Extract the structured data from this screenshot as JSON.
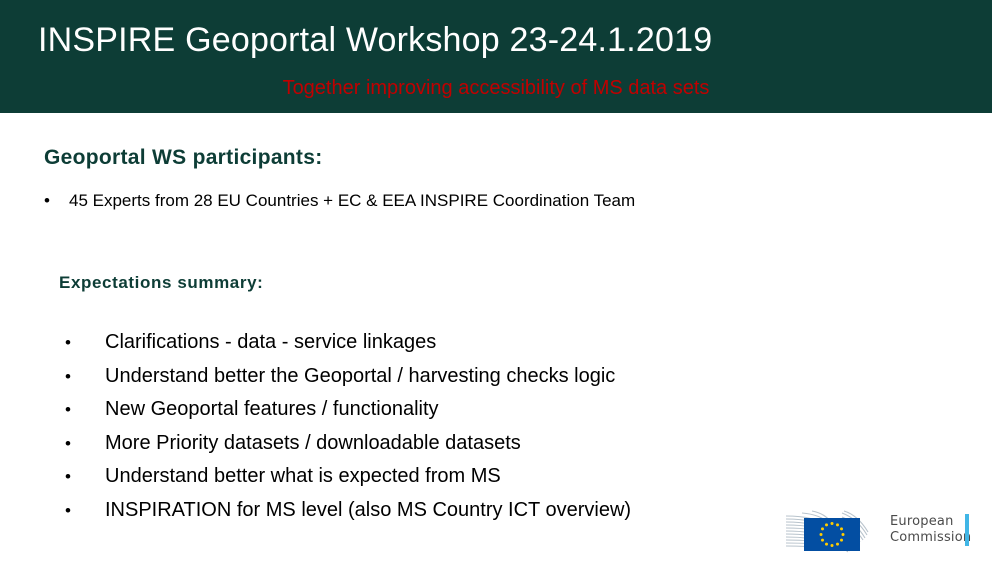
{
  "header": {
    "title": "INSPIRE Geoportal Workshop 23-24.1.2019",
    "subtitle": "Together improving accessibility of MS data sets",
    "background_color": "#0d3d36",
    "title_color": "#ffffff",
    "subtitle_color": "#c00000"
  },
  "body": {
    "participants": {
      "heading": "Geoportal WS participants:",
      "heading_color": "#0d3d36",
      "bullet_glyph": "•",
      "line": "45 Experts from 28 EU Countries + EC & EEA INSPIRE Coordination Team"
    },
    "expectations": {
      "heading": "Expectations summary:",
      "heading_color": "#0d3d36",
      "bullet_glyph": "•",
      "items": [
        "Clarifications - data - service linkages",
        "Understand better the Geoportal / harvesting checks logic",
        "New Geoportal features / functionality",
        "More Priority datasets / downloadable datasets",
        "Understand better what is expected from MS",
        "INSPIRATION for MS level (also MS Country ICT overview)"
      ]
    }
  },
  "logo": {
    "name": "european-commission-logo",
    "wordmark_line1": "European",
    "wordmark_line2": "Commission",
    "flag_color": "#034ea2",
    "star_color": "#ffcc00",
    "accent_bar_color": "#41b6e6",
    "wordmark_color": "#4a4a4a"
  }
}
